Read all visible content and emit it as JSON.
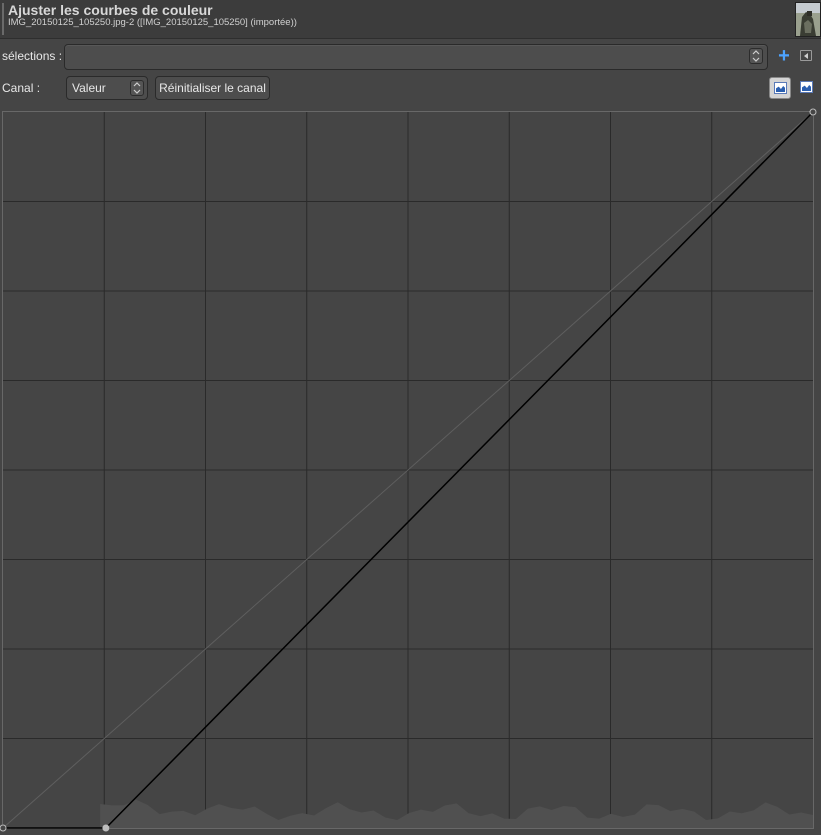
{
  "window": {
    "title": "Ajuster les courbes de couleur",
    "subtitle": "IMG_20150125_105250.jpg-2 ([IMG_20150125_105250] (importée))"
  },
  "presets": {
    "label": "sélections :",
    "value": ""
  },
  "channel": {
    "label": "Canal :",
    "value": "Valeur",
    "reset_label": "Réinitialiser le canal"
  },
  "histogram_scale": {
    "options": [
      "linear-histogram-icon",
      "logarithmic-histogram-icon"
    ],
    "selected": "linear-histogram-icon"
  },
  "curve": {
    "grid_divisions": 8,
    "control_points": [
      {
        "input": 0,
        "output": 0
      },
      {
        "input": 0.127,
        "output": 0
      },
      {
        "input": 1,
        "output": 1
      }
    ],
    "colors": {
      "background": "#454545",
      "grid": "#2a2a2a",
      "curve": "#000000",
      "reference": "#5f5f5f",
      "histogram": "#505050"
    }
  }
}
